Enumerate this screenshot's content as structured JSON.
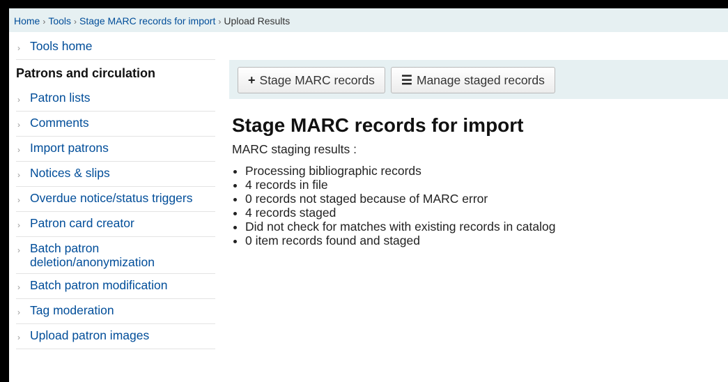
{
  "breadcrumb": {
    "home": "Home",
    "tools": "Tools",
    "stage": "Stage MARC records for import",
    "current": "Upload Results",
    "separator": "›"
  },
  "sidebar": {
    "tools_home": "Tools home",
    "heading": "Patrons and circulation",
    "items": [
      "Patron lists",
      "Comments",
      "Import patrons",
      "Notices & slips",
      "Overdue notice/status triggers",
      "Patron card creator",
      "Batch patron deletion/anonymization",
      "Batch patron modification",
      "Tag moderation",
      "Upload patron images"
    ],
    "arrow": "›"
  },
  "toolbar": {
    "stage_label": "Stage MARC records",
    "stage_icon": "+",
    "manage_label": "Manage staged records",
    "manage_icon": "☰"
  },
  "main": {
    "title": "Stage MARC records for import",
    "subtitle": "MARC staging results :",
    "results": [
      "Processing bibliographic records",
      "4 records in file",
      "0 records not staged because of MARC error",
      "4 records staged",
      "Did not check for matches with existing records in catalog",
      "0 item records found and staged"
    ]
  }
}
